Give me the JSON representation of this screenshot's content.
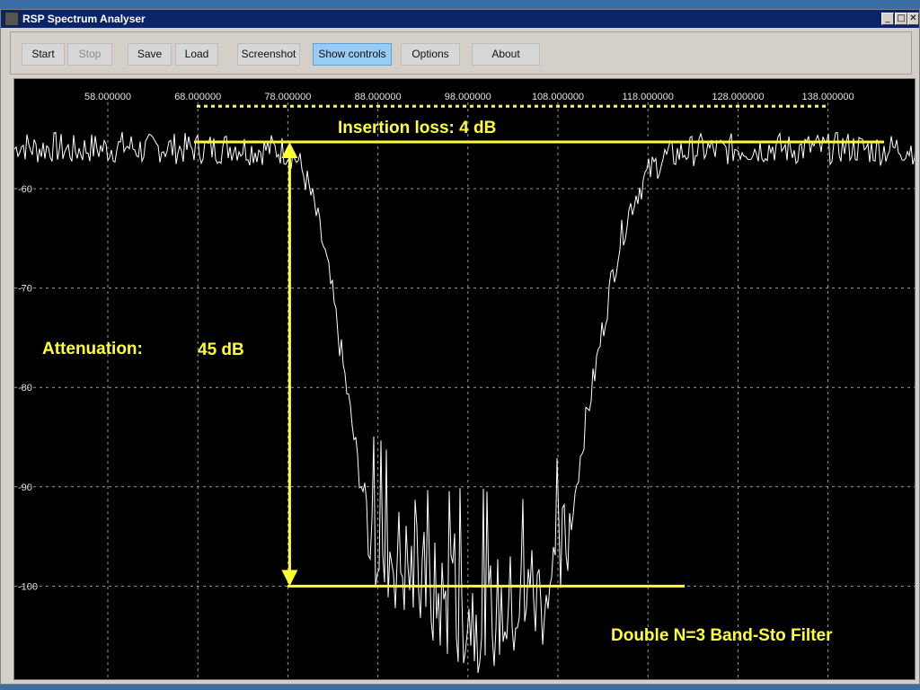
{
  "window": {
    "title": "RSP Spectrum Analyser"
  },
  "window_controls": {
    "minimize": "_",
    "maximize": "□",
    "close": "✕"
  },
  "toolbar": {
    "start_label": "Start",
    "stop_label": "Stop",
    "save_label": "Save",
    "load_label": "Load",
    "screenshot_label": "Screenshot",
    "show_controls_label": "Show controls",
    "options_label": "Options",
    "about_label": "About"
  },
  "annotations": {
    "insertion_loss": "Insertion loss: 4 dB",
    "attenuation_label": "Attenuation:",
    "attenuation_value": "45 dB",
    "filter_name": "Double N=3 Band-Sto Filter"
  },
  "colors": {
    "annotation": "#ffff33",
    "trace": "#ffffff",
    "plot_bg": "#000000",
    "active_button": "#99ccf5"
  },
  "chart_data": {
    "type": "line",
    "x_ticks": [
      "58.000000",
      "68.000000",
      "78.000000",
      "88.000000",
      "98.000000",
      "108.000000",
      "118.000000",
      "128.000000",
      "138.000000"
    ],
    "y_ticks": [
      "-60",
      "-70",
      "-80",
      "-90",
      "-100"
    ],
    "xlim": [
      48,
      148
    ],
    "ylim": [
      -109,
      -50
    ],
    "grid": true,
    "series": [
      {
        "x": [
          48,
          50,
          52,
          54,
          56,
          58,
          60,
          62,
          64,
          66,
          68,
          70,
          72,
          74,
          76,
          78,
          79,
          80,
          81,
          82,
          83,
          84,
          85,
          86,
          87,
          88,
          89,
          90,
          92,
          94,
          96,
          98,
          100,
          102,
          104,
          106,
          108,
          109,
          110,
          111,
          112,
          113,
          114,
          115,
          116,
          117,
          118,
          119,
          120,
          122,
          124,
          126,
          128,
          130,
          132,
          134,
          136,
          138,
          140,
          142,
          144,
          146,
          148
        ],
        "y": [
          -55.5,
          -56,
          -55.8,
          -56.2,
          -55.9,
          -56,
          -55.7,
          -56.1,
          -55.8,
          -56,
          -55.9,
          -56,
          -55.7,
          -56.1,
          -56,
          -56.2,
          -57,
          -59,
          -62,
          -66,
          -71,
          -77,
          -83,
          -89,
          -93,
          -95,
          -96,
          -97,
          -99,
          -101,
          -102,
          -102.5,
          -103,
          -102.5,
          -102,
          -101,
          -99,
          -95,
          -90,
          -84,
          -79,
          -74,
          -69,
          -65,
          -62,
          -60,
          -58.5,
          -57.5,
          -56.8,
          -56.3,
          -56,
          -56.2,
          -55.9,
          -56,
          -55.8,
          -56.1,
          -55.9,
          -56,
          -55.8,
          -56,
          -56.1,
          -55.9,
          -56
        ]
      }
    ],
    "markers": {
      "passband_reference_db": -55.3,
      "passband_dotted_db": -51.7,
      "stopband_reference_db": -100,
      "attenuation_freq": 78.2
    }
  }
}
